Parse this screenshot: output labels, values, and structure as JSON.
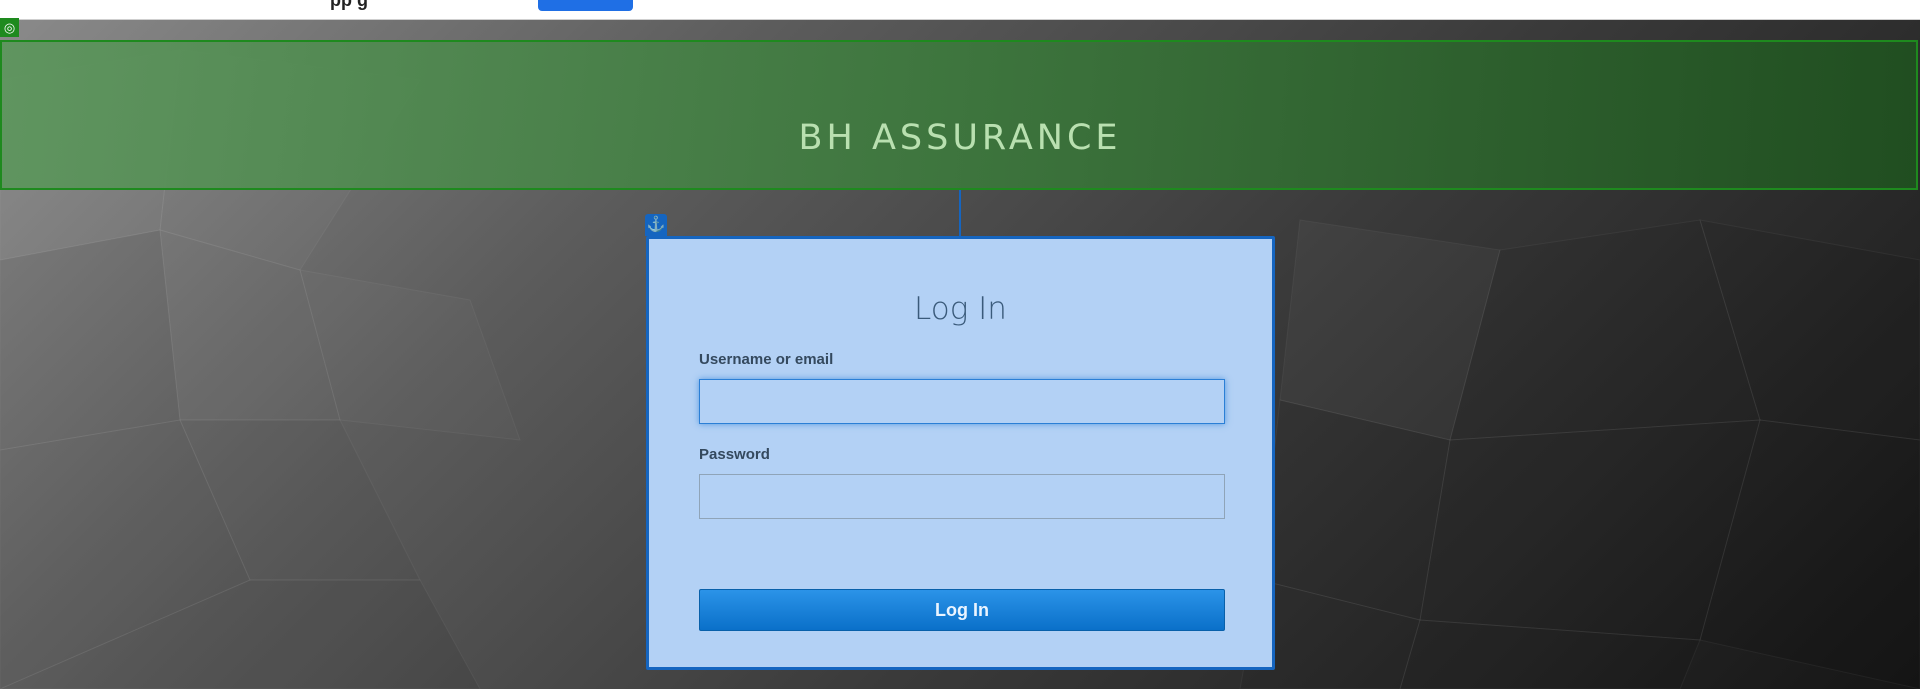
{
  "topbar": {
    "partial_text": "pp        g"
  },
  "header": {
    "title": "BH ASSURANCE",
    "badge_icon": "target-icon"
  },
  "login": {
    "title": "Log In",
    "username_label": "Username or email",
    "username_value": "",
    "password_label": "Password",
    "password_value": "",
    "submit_label": "Log In",
    "anchor_icon": "anchor-icon"
  },
  "colors": {
    "header_border": "#1e8a1e",
    "card_border": "#1565c0",
    "card_background": "#b3d1f5",
    "button": "#0a70c9",
    "title_text": "#b9e0b0"
  }
}
